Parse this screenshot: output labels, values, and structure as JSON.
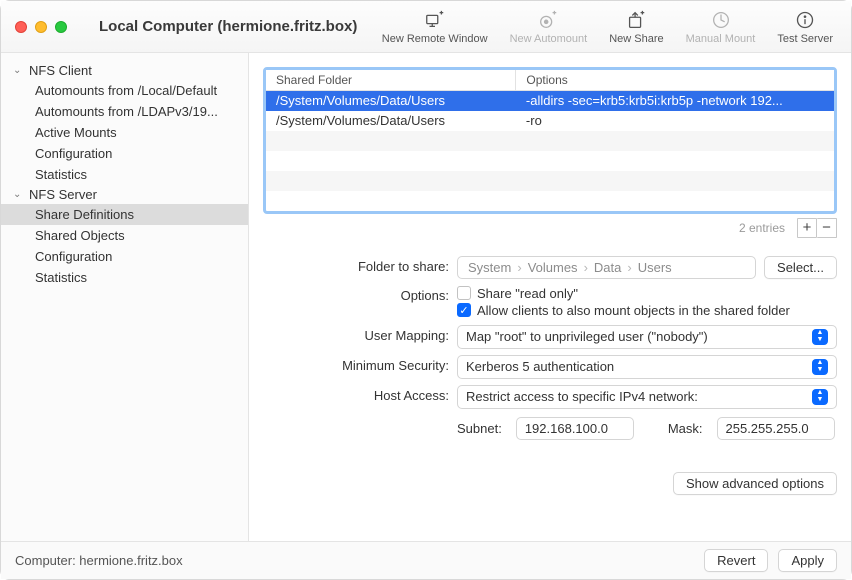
{
  "window": {
    "title": "Local Computer (hermione.fritz.box)"
  },
  "toolbar": {
    "new_remote_window": "New Remote Window",
    "new_automount": "New Automount",
    "new_share": "New Share",
    "manual_mount": "Manual Mount",
    "test_server": "Test Server"
  },
  "sidebar": {
    "client_label": "NFS Client",
    "client_items": [
      "Automounts from /Local/Default",
      "Automounts from /LDAPv3/19...",
      "Active Mounts",
      "Configuration",
      "Statistics"
    ],
    "server_label": "NFS Server",
    "server_items": [
      "Share Definitions",
      "Shared Objects",
      "Configuration",
      "Statistics"
    ],
    "selected_server_index": 0
  },
  "table": {
    "col_folder": "Shared Folder",
    "col_options": "Options",
    "rows": [
      {
        "folder": "/System/Volumes/Data/Users",
        "options": "-alldirs -sec=krb5:krb5i:krb5p -network 192..."
      },
      {
        "folder": "/System/Volumes/Data/Users",
        "options": "-ro"
      }
    ],
    "selected_index": 0,
    "count_label": "2 entries",
    "add_label": "+",
    "remove_label": "−"
  },
  "form": {
    "folder_label": "Folder to share:",
    "breadcrumb": [
      "System",
      "Volumes",
      "Data",
      "Users"
    ],
    "select_button": "Select...",
    "options_label": "Options:",
    "readonly_label": "Share \"read only\"",
    "readonly_checked": false,
    "alldirs_label": "Allow clients to also mount objects in the shared folder",
    "alldirs_checked": true,
    "user_mapping_label": "User Mapping:",
    "user_mapping_value": "Map \"root\" to unprivileged user (\"nobody\")",
    "min_sec_label": "Minimum Security:",
    "min_sec_value": "Kerberos 5 authentication",
    "host_access_label": "Host Access:",
    "host_access_value": "Restrict access to specific IPv4 network:",
    "subnet_label": "Subnet:",
    "subnet_value": "192.168.100.0",
    "mask_label": "Mask:",
    "mask_value": "255.255.255.0",
    "advanced_button": "Show advanced options"
  },
  "statusbar": {
    "computer_label": "Computer: hermione.fritz.box",
    "revert": "Revert",
    "apply": "Apply"
  }
}
